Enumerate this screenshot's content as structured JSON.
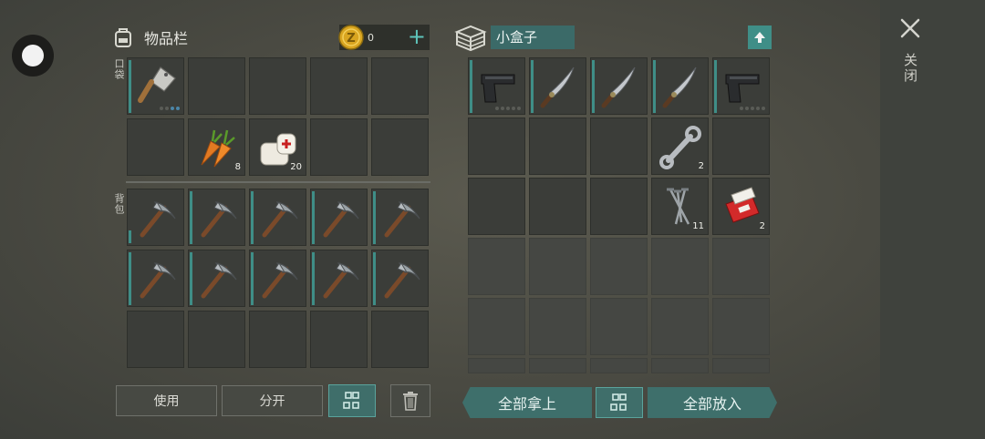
{
  "inventory": {
    "title": "物品栏",
    "coins": "0",
    "pocket_label": "口袋",
    "backpack_label": "背包",
    "pocket_slots": [
      {
        "icon": "cleaver-icon",
        "qty": ""
      },
      {
        "icon": "",
        "qty": ""
      },
      {
        "icon": "",
        "qty": ""
      },
      {
        "icon": "",
        "qty": ""
      },
      {
        "icon": "",
        "qty": ""
      },
      {
        "icon": "",
        "qty": ""
      },
      {
        "icon": "carrot-icon",
        "qty": "8"
      },
      {
        "icon": "bandage-icon",
        "qty": "20"
      },
      {
        "icon": "",
        "qty": ""
      },
      {
        "icon": "",
        "qty": ""
      }
    ],
    "backpack_slots": [
      {
        "icon": "pickaxe-icon",
        "qty": ""
      },
      {
        "icon": "pickaxe-icon",
        "qty": ""
      },
      {
        "icon": "pickaxe-icon",
        "qty": ""
      },
      {
        "icon": "pickaxe-icon",
        "qty": ""
      },
      {
        "icon": "pickaxe-icon",
        "qty": ""
      },
      {
        "icon": "pickaxe-icon",
        "qty": ""
      },
      {
        "icon": "pickaxe-icon",
        "qty": ""
      },
      {
        "icon": "pickaxe-icon",
        "qty": ""
      },
      {
        "icon": "pickaxe-icon",
        "qty": ""
      },
      {
        "icon": "pickaxe-icon",
        "qty": ""
      },
      {
        "icon": "",
        "qty": ""
      },
      {
        "icon": "",
        "qty": ""
      },
      {
        "icon": "",
        "qty": ""
      },
      {
        "icon": "",
        "qty": ""
      },
      {
        "icon": "",
        "qty": ""
      }
    ],
    "buttons": {
      "use": "使用",
      "split": "分开"
    }
  },
  "container": {
    "name": "小盒子",
    "slots": [
      {
        "icon": "pistol-icon",
        "qty": ""
      },
      {
        "icon": "machete-icon",
        "qty": ""
      },
      {
        "icon": "machete-icon",
        "qty": ""
      },
      {
        "icon": "machete-icon",
        "qty": ""
      },
      {
        "icon": "pistol-icon",
        "qty": ""
      },
      {
        "icon": "",
        "qty": ""
      },
      {
        "icon": "",
        "qty": ""
      },
      {
        "icon": "",
        "qty": ""
      },
      {
        "icon": "wrench-icon",
        "qty": "2"
      },
      {
        "icon": "",
        "qty": ""
      },
      {
        "icon": "",
        "qty": ""
      },
      {
        "icon": "",
        "qty": ""
      },
      {
        "icon": "",
        "qty": ""
      },
      {
        "icon": "nails-icon",
        "qty": "11"
      },
      {
        "icon": "cigarettes-icon",
        "qty": "2"
      }
    ],
    "buttons": {
      "take_all": "全部拿上",
      "put_all": "全部放入"
    }
  },
  "close_label": "关闭",
  "colors": {
    "accent": "#3f8e87",
    "coin": "#d9a520"
  }
}
